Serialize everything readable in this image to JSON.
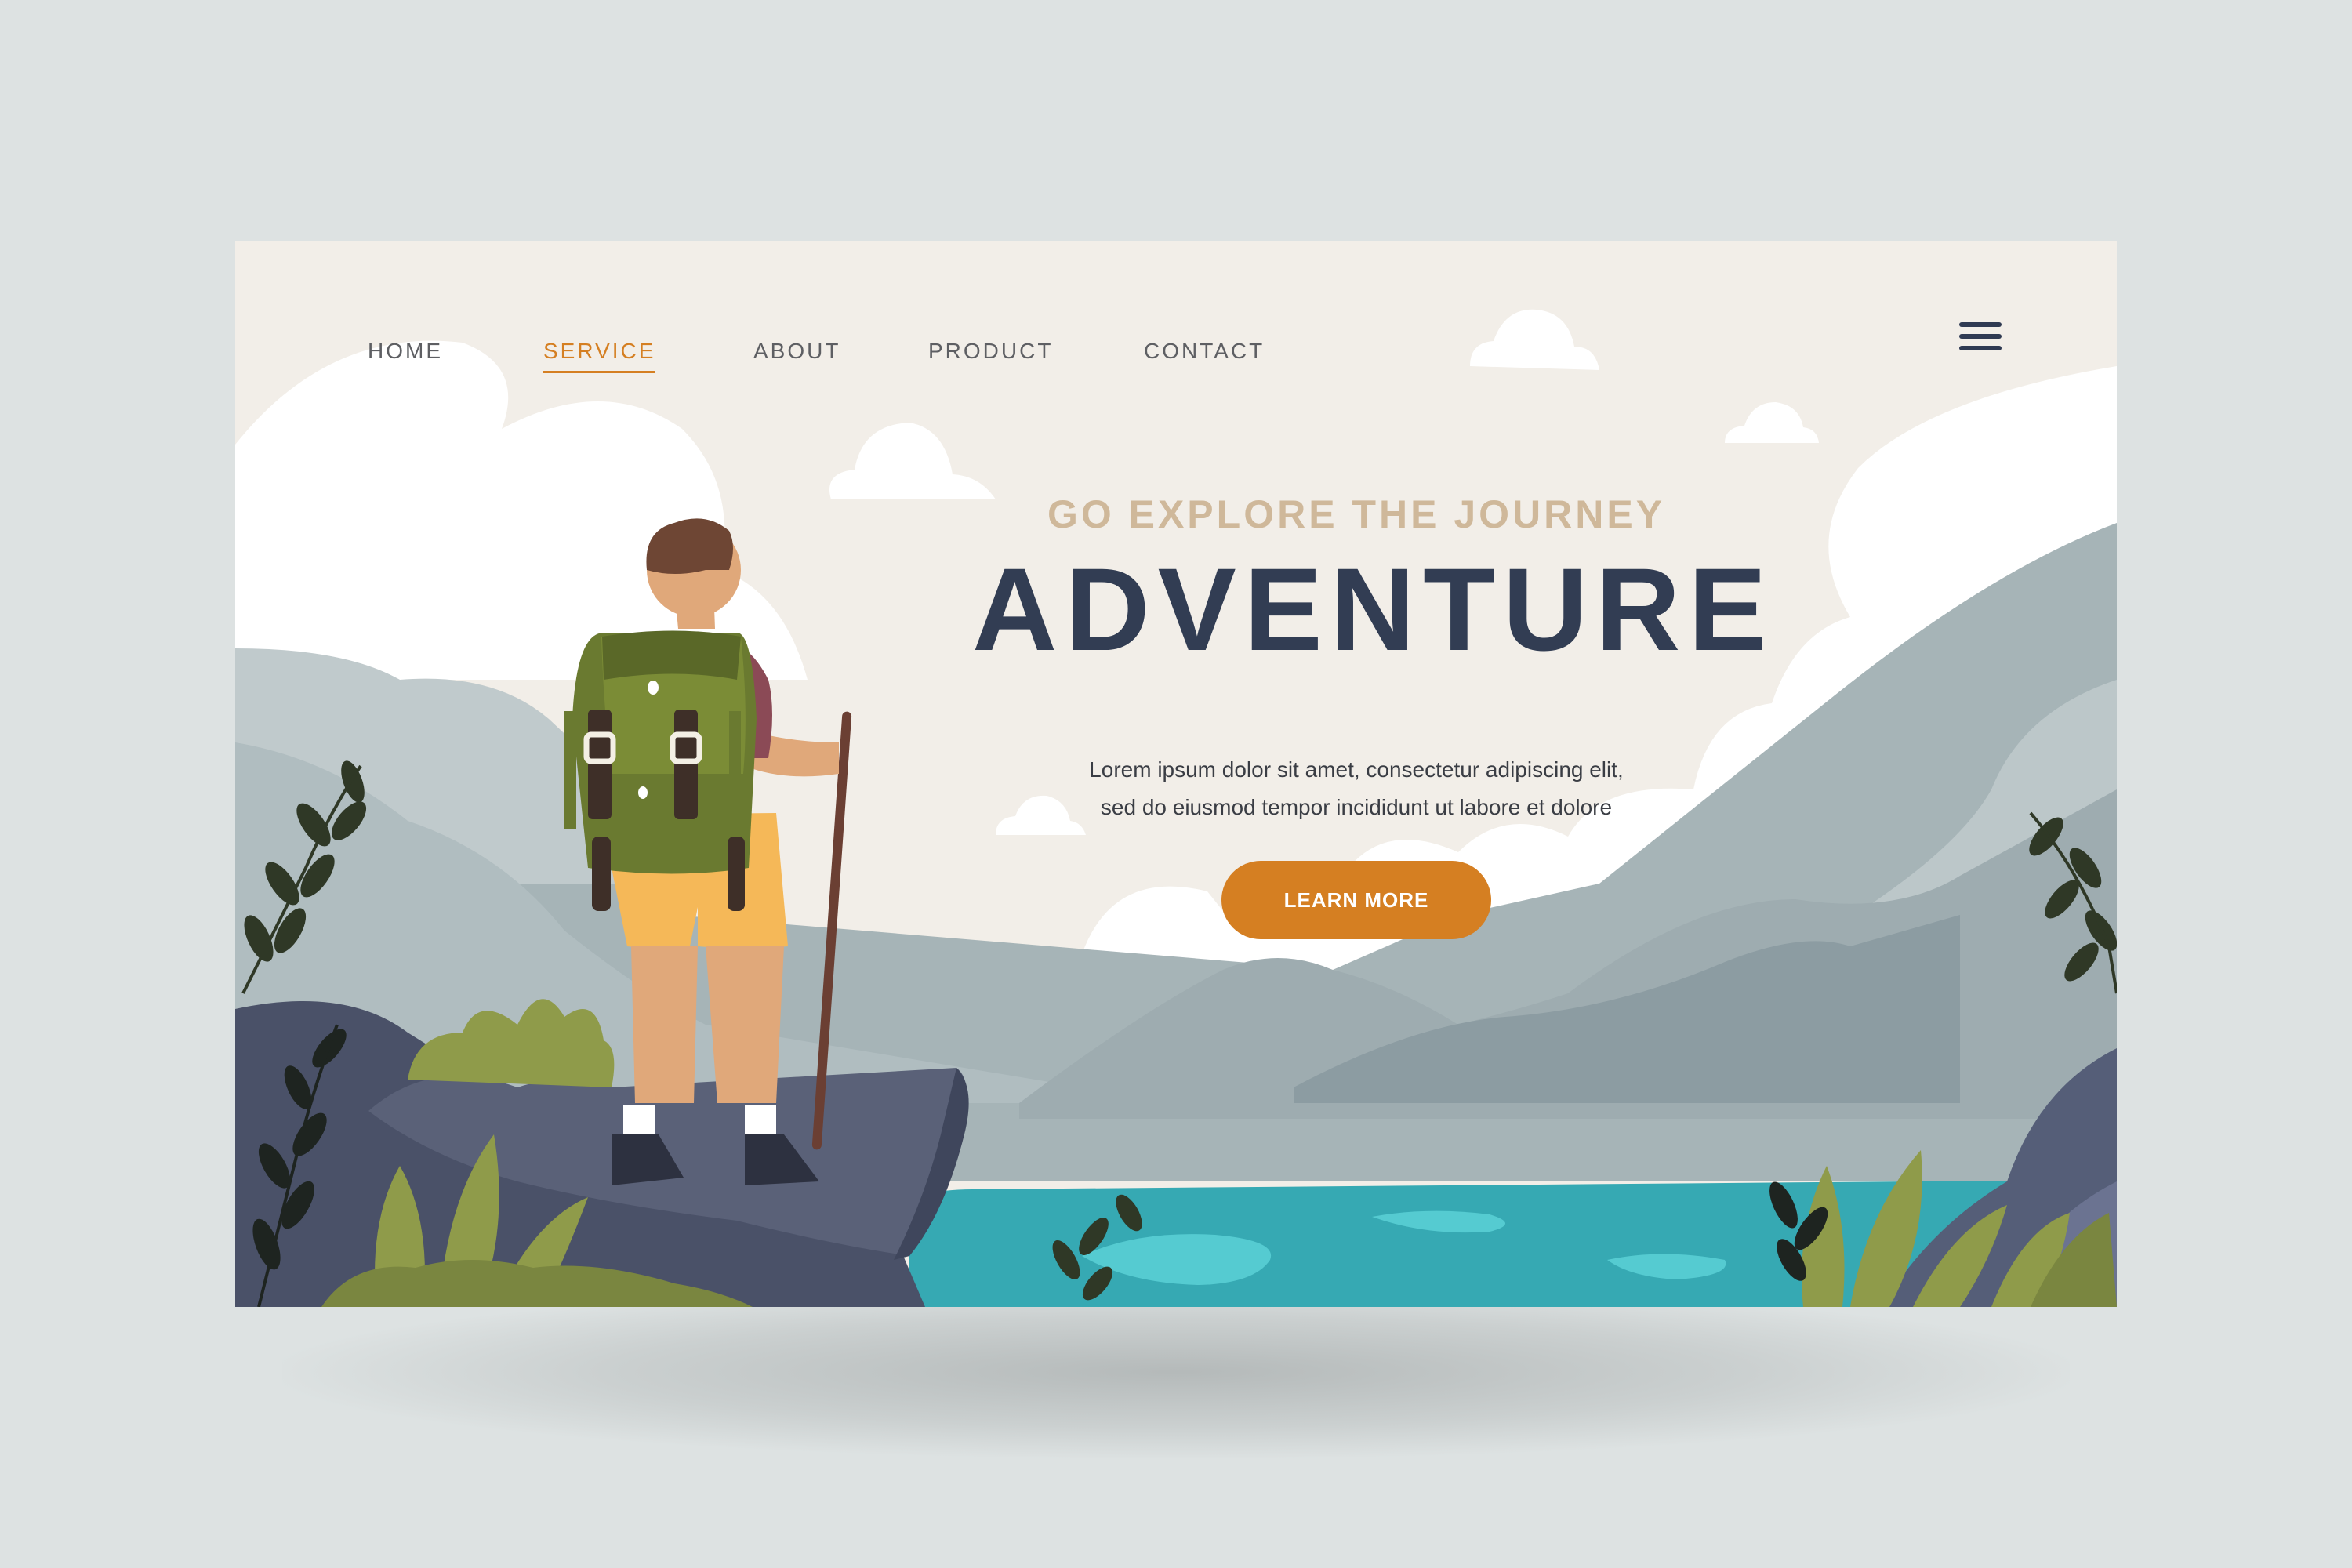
{
  "nav": {
    "items": [
      {
        "label": "HOME",
        "active": false
      },
      {
        "label": "SERVICE",
        "active": true
      },
      {
        "label": "ABOUT",
        "active": false
      },
      {
        "label": "PRODUCT",
        "active": false
      },
      {
        "label": "CONTACT",
        "active": false
      }
    ],
    "menu_icon": "hamburger-menu-icon"
  },
  "hero": {
    "eyebrow": "GO EXPLORE THE JOURNEY",
    "title": "ADVENTURE",
    "description_line1": "Lorem ipsum dolor sit amet, consectetur adipiscing elit,",
    "description_line2": "sed do eiusmod tempor incididunt ut labore et dolore",
    "cta_label": "LEARN MORE"
  },
  "colors": {
    "accent": "#d57f22",
    "headline": "#323d53",
    "eyebrow": "#cfb89a",
    "page_bg": "#f2eee8",
    "outer_bg": "#dde2e2",
    "water": "#36a9b3",
    "foliage": "#8f9b4a"
  }
}
